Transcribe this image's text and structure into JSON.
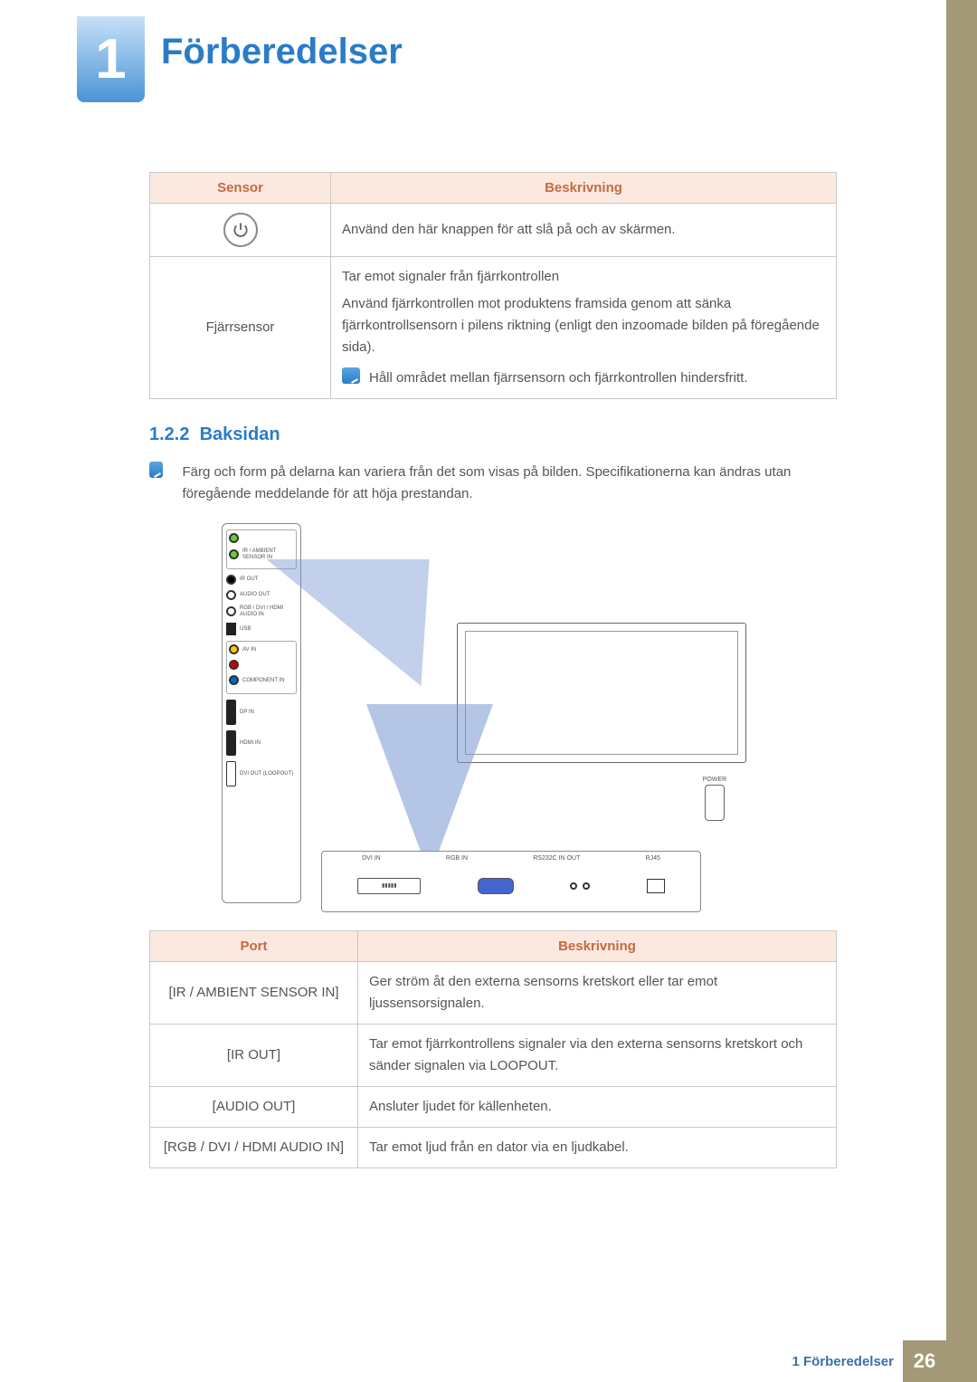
{
  "chapter": {
    "number": "1",
    "title": "Förberedelser"
  },
  "sensor_table": {
    "headers": [
      "Sensor",
      "Beskrivning"
    ],
    "rows": [
      {
        "sensor_icon": "power-icon",
        "desc": "Använd den här knappen för att slå på och av skärmen."
      },
      {
        "sensor_label": "Fjärrsensor",
        "desc_lines": [
          "Tar emot signaler från fjärrkontrollen",
          "Använd fjärrkontrollen mot produktens framsida genom att sänka fjärrkontrollsensorn i pilens riktning (enligt den inzoomade bilden på föregående sida)."
        ],
        "note": "Håll området mellan fjärrsensorn och fjärrkontrollen hindersfritt."
      }
    ]
  },
  "section": {
    "number": "1.2.2",
    "title": "Baksidan",
    "note": "Färg och form på delarna kan variera från det som visas på bilden. Specifikationerna kan ändras utan föregående meddelande för att höja prestandan."
  },
  "diagram": {
    "side_ports": [
      "IR / AMBIENT SENSOR IN",
      "IR OUT",
      "AUDIO OUT",
      "RGB / DVI / HDMI AUDIO IN",
      "USB",
      "AV IN",
      "COMPONENT IN",
      "DP IN",
      "HDMI IN",
      "DVI OUT (LOOPOUT)"
    ],
    "bottom_ports": [
      "DVI IN",
      "RGB IN",
      "RS232C IN  OUT",
      "RJ45"
    ],
    "power_label": "POWER"
  },
  "port_table": {
    "headers": [
      "Port",
      "Beskrivning"
    ],
    "rows": [
      {
        "port": "[IR / AMBIENT SENSOR IN]",
        "desc": "Ger ström åt den externa sensorns kretskort eller tar emot ljussensorsignalen."
      },
      {
        "port": "[IR OUT]",
        "desc": "Tar emot fjärrkontrollens signaler via den externa sensorns kretskort och sänder signalen via LOOPOUT."
      },
      {
        "port": "[AUDIO OUT]",
        "desc": "Ansluter ljudet för källenheten."
      },
      {
        "port": "[RGB / DVI / HDMI AUDIO IN]",
        "desc": "Tar emot ljud från en dator via en ljudkabel."
      }
    ]
  },
  "footer": {
    "text": "1 Förberedelser",
    "page": "26"
  }
}
